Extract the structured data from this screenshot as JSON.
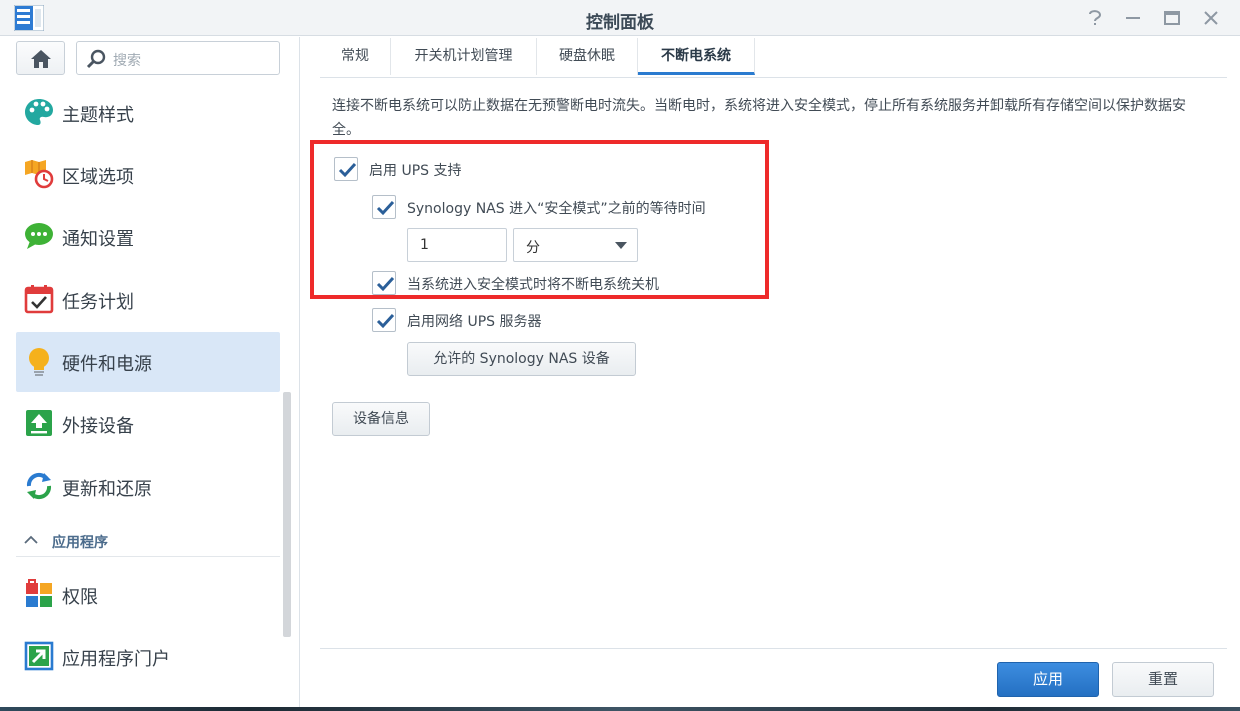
{
  "window": {
    "title": "控制面板",
    "controls": [
      "help",
      "minimize",
      "maximize",
      "close"
    ]
  },
  "sidebar": {
    "search_placeholder": "搜索",
    "items": [
      {
        "label": "主题样式",
        "icon": "palette-icon"
      },
      {
        "label": "区域选项",
        "icon": "map-clock-icon"
      },
      {
        "label": "通知设置",
        "icon": "chat-bubble-icon"
      },
      {
        "label": "任务计划",
        "icon": "calendar-check-icon"
      },
      {
        "label": "硬件和电源",
        "icon": "lightbulb-icon",
        "active": true
      },
      {
        "label": "外接设备",
        "icon": "upload-icon"
      },
      {
        "label": "更新和还原",
        "icon": "refresh-icon"
      },
      {
        "label": "权限",
        "icon": "permission-blocks-icon"
      },
      {
        "label": "应用程序门户",
        "icon": "portal-arrow-icon"
      }
    ],
    "section_label": "应用程序"
  },
  "tabs": [
    {
      "label": "常规"
    },
    {
      "label": "开关机计划管理"
    },
    {
      "label": "硬盘休眠"
    },
    {
      "label": "不断电系统",
      "active": true
    }
  ],
  "content": {
    "description": "连接不断电系统可以防止数据在无预警断电时流失。当断电时，系统将进入安全模式，停止所有系统服务并卸载所有存储空间以保护数据安全。",
    "enable_ups": {
      "label": "启用 UPS 支持",
      "checked": true
    },
    "wait_time": {
      "label": "Synology NAS 进入“安全模式”之前的等待时间",
      "checked": true
    },
    "wait_value": "1",
    "wait_unit": "分",
    "shutdown_ups": {
      "label": "当系统进入安全模式时将不断电系统关机",
      "checked": true
    },
    "network_ups": {
      "label": "启用网络 UPS 服务器",
      "checked": true
    },
    "allowed_devices_button": "允许的 Synology NAS 设备",
    "device_info_button": "设备信息"
  },
  "footer": {
    "apply": "应用",
    "reset": "重置"
  },
  "colors": {
    "accent": "#2a7bd0",
    "highlight_box": "#ee2a2a",
    "active_nav_bg": "#d9e7f7",
    "checkmark": "#2b5f99"
  }
}
